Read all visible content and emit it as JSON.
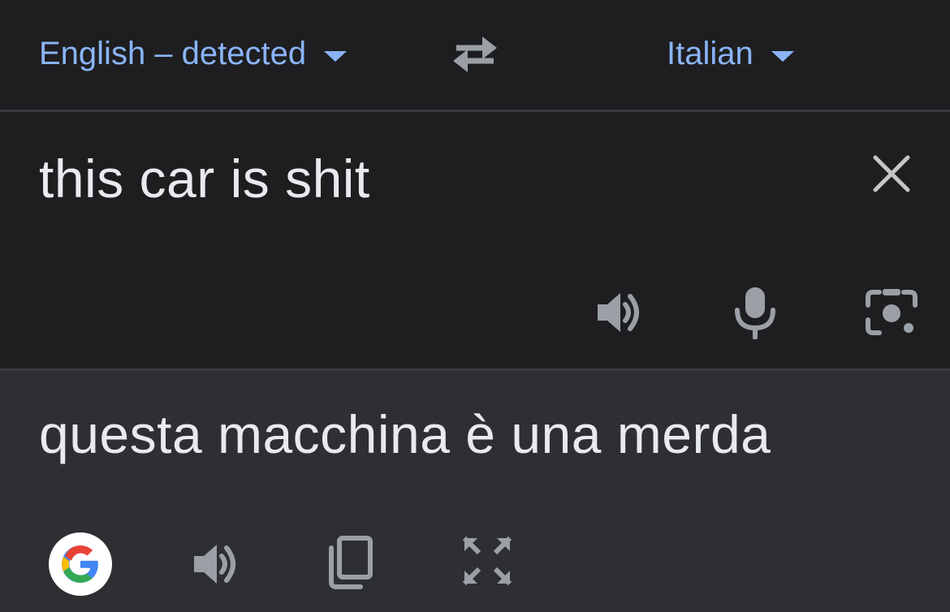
{
  "language_bar": {
    "source_language": "English – detected",
    "target_language": "Italian",
    "swap_icon": "swap-arrows-icon"
  },
  "source": {
    "text": "this car is shit",
    "icons": [
      "close-icon",
      "speaker-icon",
      "microphone-icon",
      "camera-icon"
    ]
  },
  "target": {
    "text": "questa macchina è una merda",
    "icons": [
      "google-logo-icon",
      "speaker-icon",
      "copy-icon",
      "fullscreen-icon"
    ]
  },
  "colors": {
    "background": "#1e1e20",
    "target_background": "#2e2f33",
    "accent": "#8ab4f8",
    "text": "#e8eaed",
    "icon": "#9aa0a6"
  }
}
